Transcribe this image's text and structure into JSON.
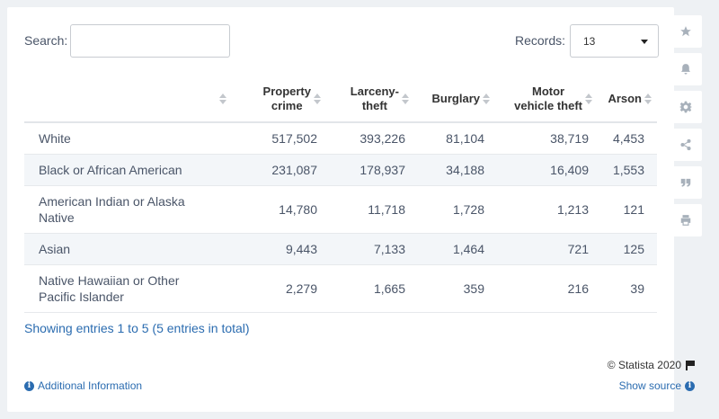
{
  "search": {
    "label": "Search:",
    "value": ""
  },
  "records": {
    "label": "Records:",
    "value": "13"
  },
  "table": {
    "headers": [
      "",
      "Property\ncrime",
      "Larceny-\ntheft",
      "Burglary",
      "Motor\nvehicle theft",
      "Arson"
    ],
    "rows": [
      [
        "White",
        "517,502",
        "393,226",
        "81,104",
        "38,719",
        "4,453"
      ],
      [
        "Black or African American",
        "231,087",
        "178,937",
        "34,188",
        "16,409",
        "1,553"
      ],
      [
        "American Indian or Alaska Native",
        "14,780",
        "11,718",
        "1,728",
        "1,213",
        "121"
      ],
      [
        "Asian",
        "9,443",
        "7,133",
        "1,464",
        "721",
        "125"
      ],
      [
        "Native Hawaiian or Other Pacific Islander",
        "2,279",
        "1,665",
        "359",
        "216",
        "39"
      ]
    ]
  },
  "footer": {
    "entries": "Showing entries 1 to 5 (5 entries in total)",
    "copyright": "© Statista 2020",
    "additional_info": "Additional Information",
    "show_source": "Show source"
  },
  "sidebar": {
    "icons": [
      "star-icon",
      "bell-icon",
      "gear-icon",
      "share-icon",
      "quote-icon",
      "print-icon"
    ]
  },
  "colors": {
    "link": "#2b6cb0",
    "row_alt": "#f3f6f9",
    "icon": "#a8b1bb"
  }
}
